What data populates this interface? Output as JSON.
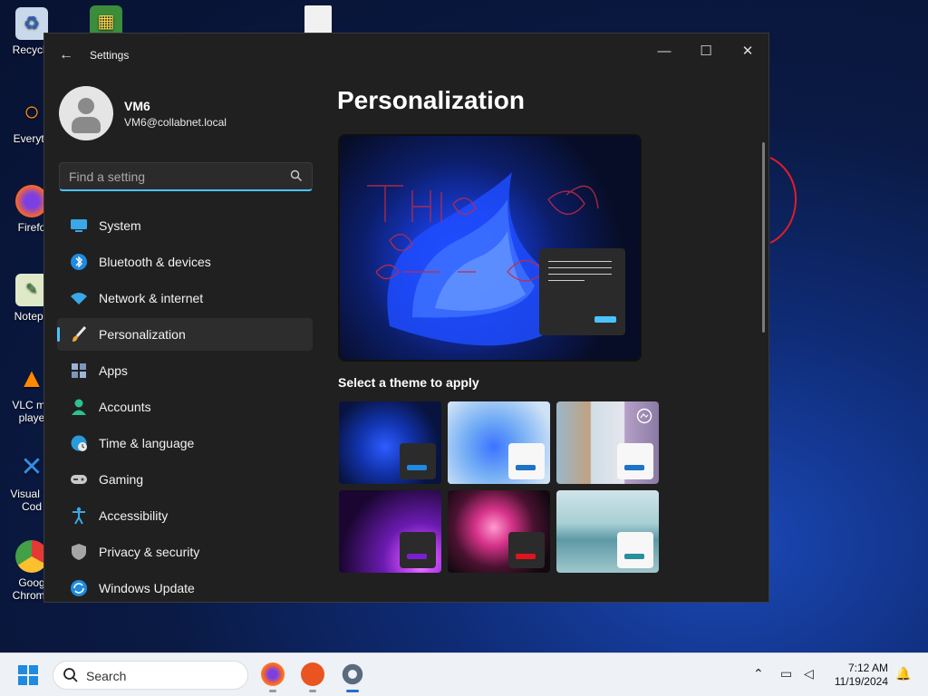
{
  "desktop": {
    "icons": [
      {
        "label": "Recycle",
        "icon": "recycle-bin-icon"
      },
      {
        "label": "",
        "icon": "app-icon"
      },
      {
        "label": "",
        "icon": "file-icon"
      },
      {
        "label": "Everyth",
        "icon": "everything-search-icon"
      },
      {
        "label": "Firefo",
        "icon": "firefox-icon"
      },
      {
        "label": "Notepa",
        "icon": "notepad-icon"
      },
      {
        "label": "VLC me\nplaye",
        "icon": "vlc-icon"
      },
      {
        "label": "Visual St\nCod",
        "icon": "vscode-icon"
      },
      {
        "label": "Goog\nChrome",
        "icon": "chrome-icon"
      }
    ]
  },
  "window": {
    "title": "Settings",
    "controls": {
      "minimize": "—",
      "maximize": "☐",
      "close": "✕"
    }
  },
  "profile": {
    "name": "VM6",
    "email": "VM6@collabnet.local"
  },
  "search": {
    "placeholder": "Find a setting",
    "value": ""
  },
  "nav": {
    "items": [
      {
        "label": "System",
        "icon": "system-icon",
        "active": false
      },
      {
        "label": "Bluetooth & devices",
        "icon": "bluetooth-icon",
        "active": false
      },
      {
        "label": "Network & internet",
        "icon": "wifi-icon",
        "active": false
      },
      {
        "label": "Personalization",
        "icon": "paintbrush-icon",
        "active": true
      },
      {
        "label": "Apps",
        "icon": "apps-icon",
        "active": false
      },
      {
        "label": "Accounts",
        "icon": "accounts-icon",
        "active": false
      },
      {
        "label": "Time & language",
        "icon": "clock-globe-icon",
        "active": false
      },
      {
        "label": "Gaming",
        "icon": "gamepad-icon",
        "active": false
      },
      {
        "label": "Accessibility",
        "icon": "accessibility-icon",
        "active": false
      },
      {
        "label": "Privacy & security",
        "icon": "shield-icon",
        "active": false
      },
      {
        "label": "Windows Update",
        "icon": "update-icon",
        "active": false
      }
    ]
  },
  "main": {
    "title": "Personalization",
    "section_title": "Select a theme to apply",
    "themes": [
      {
        "name": "windows-dark",
        "selected": false
      },
      {
        "name": "windows-light",
        "selected": false
      },
      {
        "name": "spotlight",
        "selected": false
      },
      {
        "name": "glow",
        "selected": false
      },
      {
        "name": "captured-motion",
        "selected": false
      },
      {
        "name": "flow",
        "selected": false
      }
    ]
  },
  "taskbar": {
    "search_label": "Search",
    "apps": [
      "firefox-icon",
      "ubuntu-icon",
      "settings-gear-icon"
    ],
    "time": "7:12 AM",
    "date": "11/19/2024"
  },
  "colors": {
    "accent": "#4cc2ff",
    "window_bg": "#202020",
    "active_nav": "#2d2d2d"
  }
}
